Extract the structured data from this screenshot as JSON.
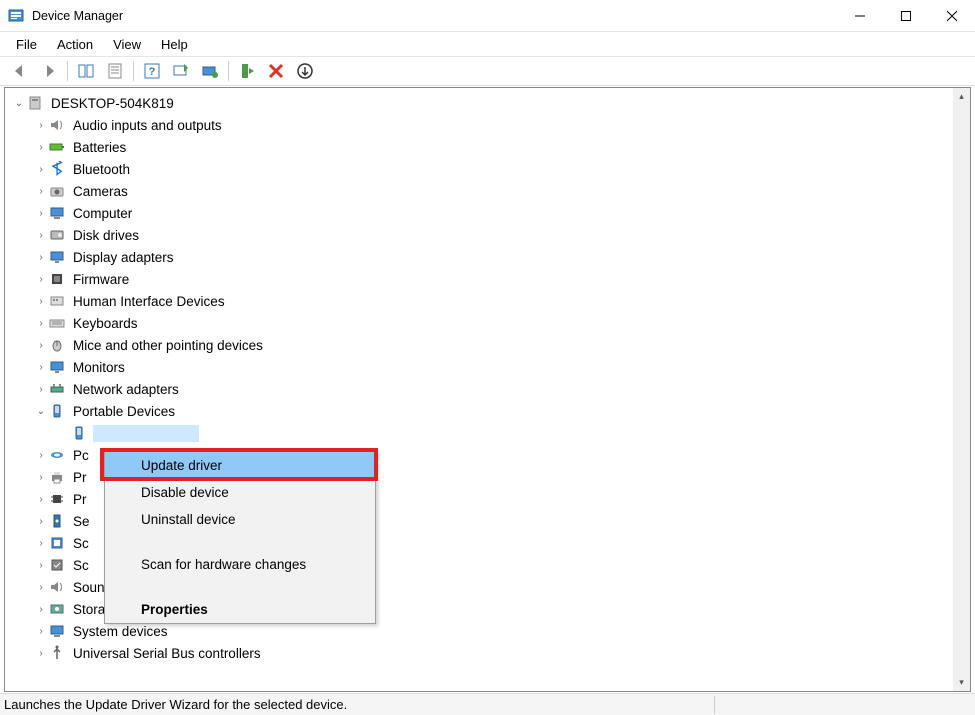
{
  "window": {
    "title": "Device Manager",
    "minimize": "—",
    "maximize": "▢",
    "close": "✕"
  },
  "menus": [
    "File",
    "Action",
    "View",
    "Help"
  ],
  "root": {
    "computer_name": "DESKTOP-504K819"
  },
  "categories": [
    {
      "label": "Audio inputs and outputs",
      "icon": "speaker"
    },
    {
      "label": "Batteries",
      "icon": "battery"
    },
    {
      "label": "Bluetooth",
      "icon": "bluetooth"
    },
    {
      "label": "Cameras",
      "icon": "camera"
    },
    {
      "label": "Computer",
      "icon": "computer"
    },
    {
      "label": "Disk drives",
      "icon": "disk"
    },
    {
      "label": "Display adapters",
      "icon": "display"
    },
    {
      "label": "Firmware",
      "icon": "firmware"
    },
    {
      "label": "Human Interface Devices",
      "icon": "hid"
    },
    {
      "label": "Keyboards",
      "icon": "keyboard"
    },
    {
      "label": "Mice and other pointing devices",
      "icon": "mouse"
    },
    {
      "label": "Monitors",
      "icon": "monitor"
    },
    {
      "label": "Network adapters",
      "icon": "network"
    },
    {
      "label": "Portable Devices",
      "icon": "portable",
      "expanded": true
    },
    {
      "label": "Pc",
      "icon": "port",
      "truncated": true
    },
    {
      "label": "Pr",
      "icon": "print",
      "truncated": true
    },
    {
      "label": "Pr",
      "icon": "processor",
      "truncated": true
    },
    {
      "label": "Se",
      "icon": "security",
      "truncated": true
    },
    {
      "label": "Sc",
      "icon": "software",
      "truncated": true
    },
    {
      "label": "Sc",
      "icon": "software2",
      "truncated": true
    },
    {
      "label": "Sound, video and game controllers",
      "icon": "sound",
      "partial": true
    },
    {
      "label": "Storage controllers",
      "icon": "storage"
    },
    {
      "label": "System devices",
      "icon": "system"
    },
    {
      "label": "Universal Serial Bus controllers",
      "icon": "usb",
      "cut": true
    }
  ],
  "context_menu": {
    "items": [
      {
        "label": "Update driver",
        "highlighted": true
      },
      {
        "label": "Disable device"
      },
      {
        "label": "Uninstall device"
      }
    ],
    "items2": [
      {
        "label": "Scan for hardware changes"
      }
    ],
    "items3": [
      {
        "label": "Properties",
        "bold": true
      }
    ]
  },
  "status_text": "Launches the Update Driver Wizard for the selected device."
}
